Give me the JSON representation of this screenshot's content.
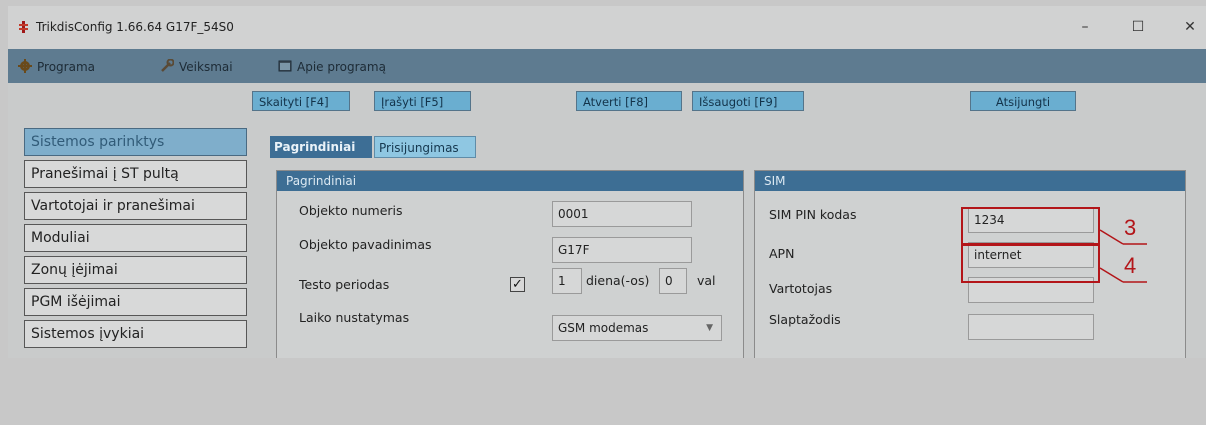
{
  "window": {
    "title": "TrikdisConfig 1.66.64   G17F_54S0",
    "minimize_glyph": "–",
    "maximize_glyph": "☐",
    "close_glyph": "✕"
  },
  "menu": {
    "items": [
      {
        "label": "Programa",
        "icon": "gear-icon"
      },
      {
        "label": "Veiksmai",
        "icon": "wrench-icon"
      },
      {
        "label": "Apie programą",
        "icon": "info-window-icon"
      }
    ]
  },
  "toolbar": {
    "read": "Skaityti [F4]",
    "write": "Įrašyti [F5]",
    "open": "Atverti [F8]",
    "save": "Išsaugoti [F9]",
    "disconnect": "Atsijungti"
  },
  "sidebar": {
    "items": [
      {
        "label": "Sistemos parinktys"
      },
      {
        "label": "Pranešimai į ST pultą"
      },
      {
        "label": "Vartotojai ir pranešimai"
      },
      {
        "label": "Moduliai"
      },
      {
        "label": "Zonų įėjimai"
      },
      {
        "label": "PGM išėjimai"
      },
      {
        "label": "Sistemos įvykiai"
      }
    ]
  },
  "tabs": [
    {
      "label": "Pagrindiniai"
    },
    {
      "label": "Prisijungimas"
    }
  ],
  "main_group": {
    "title": "Pagrindiniai",
    "object_number_label": "Objekto numeris",
    "object_number_value": "0001",
    "object_name_label": "Objekto pavadinimas",
    "object_name_value": "G17F",
    "test_period_label": "Testo periodas",
    "test_period_checked": true,
    "test_days_value": "1",
    "test_days_unit": "diena(-os)",
    "test_hours_value": "0",
    "test_hours_unit": "val",
    "time_setting_label": "Laiko nustatymas",
    "time_setting_value": "GSM modemas"
  },
  "sim_group": {
    "title": "SIM",
    "pin_label": "SIM PIN kodas",
    "pin_value": "1234",
    "apn_label": "APN",
    "apn_value": "internet",
    "user_label": "Vartotojas",
    "user_value": "",
    "password_label": "Slaptažodis",
    "password_value": ""
  },
  "annotations": {
    "pin_marker": "3",
    "apn_marker": "4",
    "color": "#b31519"
  }
}
